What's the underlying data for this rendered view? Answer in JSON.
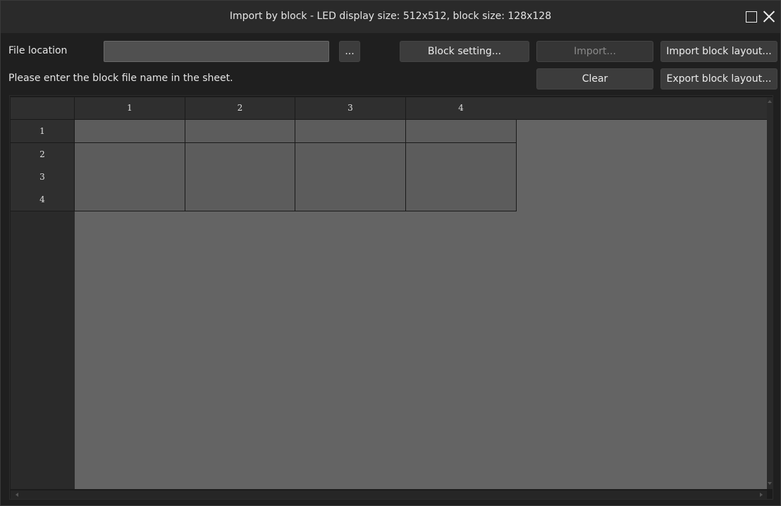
{
  "window": {
    "title": "Import by block - LED display size: 512x512, block size: 128x128"
  },
  "form": {
    "file_location_label": "File location",
    "file_location_value": "",
    "browse_label": "...",
    "instruction": "Please enter the block file name in the sheet."
  },
  "buttons": {
    "block_setting": "Block setting...",
    "import": "Import...",
    "import_block_layout": "Import block layout...",
    "clear": "Clear",
    "export_block_layout": "Export block layout..."
  },
  "sheet": {
    "column_headers": [
      "1",
      "2",
      "3",
      "4"
    ],
    "row_headers": [
      "1",
      "2",
      "3",
      "4"
    ],
    "cells": [
      [
        "",
        "",
        "",
        ""
      ],
      [
        "",
        "",
        "",
        ""
      ],
      [
        "",
        "",
        "",
        ""
      ],
      [
        "",
        "",
        "",
        ""
      ]
    ]
  }
}
